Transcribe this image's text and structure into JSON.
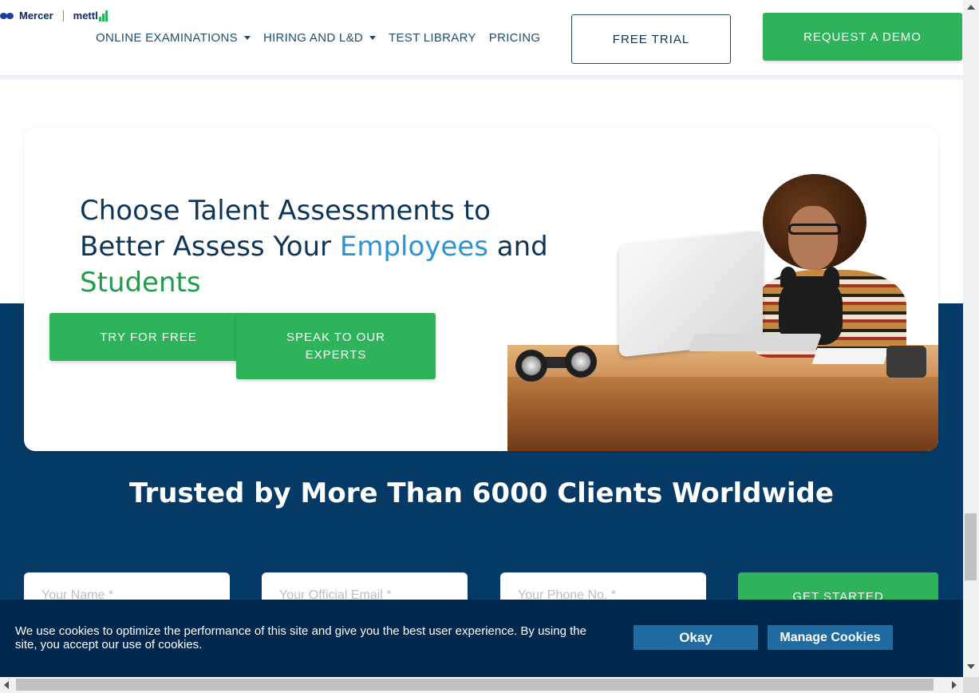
{
  "header": {
    "logo_primary": "Mercer",
    "logo_secondary": "mettl",
    "nav": [
      {
        "label": "ONLINE EXAMINATIONS",
        "has_dropdown": true
      },
      {
        "label": "HIRING AND L&D",
        "has_dropdown": true
      },
      {
        "label": "TEST LIBRARY",
        "has_dropdown": false
      },
      {
        "label": "PRICING",
        "has_dropdown": false
      }
    ],
    "free_trial_label": "FREE TRIAL",
    "request_demo_label": "REQUEST A DEMO"
  },
  "hero": {
    "title_part1": "Choose Talent Assessments to Better Assess Your ",
    "title_highlight1": "Employees",
    "title_mid": " and ",
    "title_highlight2": "Students",
    "try_label": "TRY FOR FREE",
    "speak_label": "SPEAK TO OUR EXPERTS"
  },
  "trusted": {
    "heading": "Trusted by More Than 6000 Clients Worldwide"
  },
  "form": {
    "name_placeholder": "Your Name *",
    "email_placeholder": "Your Official Email *",
    "phone_placeholder": "Your Phone No. *",
    "submit_label": "GET STARTED"
  },
  "cookie": {
    "text": "We use cookies to optimize the performance of this site and give you the best user experience. By using the site, you accept our use of cookies.",
    "okay_label": "Okay",
    "manage_label": "Manage Cookies"
  },
  "colors": {
    "brand_green": "#2eb35a",
    "navy": "#053a66",
    "accent_blue": "#2a95d0",
    "cookie_bg": "#00274d"
  }
}
